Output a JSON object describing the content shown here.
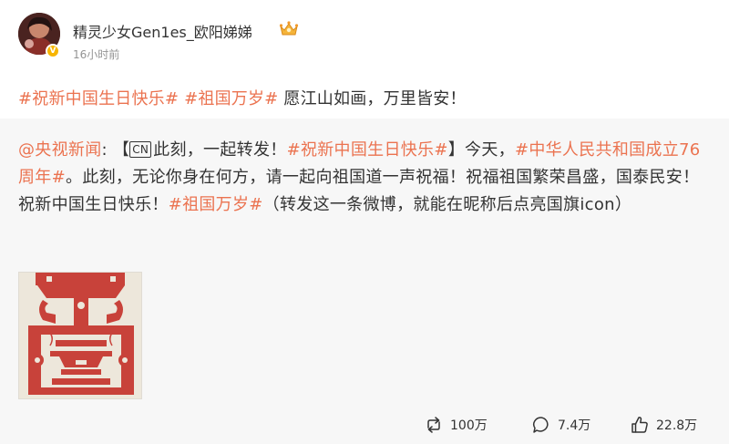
{
  "author": {
    "name": "精灵少女Gen1es_欧阳娣娣",
    "time": "16小时前",
    "verified_color": "#f7b500"
  },
  "post": {
    "topic1": "#祝新中国生日快乐#",
    "topic2": "#祖国万岁#",
    "text": " 愿江山如画，万里皆安！"
  },
  "retweet": {
    "mention": "@央视新闻",
    "sep": ": 【",
    "badge": "CN",
    "seg1": "此刻，一起转发！",
    "topic1": "#祝新中国生日快乐#",
    "seg2": "】今天，",
    "topic2": "#中华人民共和国成立76周年#",
    "seg3": "。此刻，无论你身在何方，请一起向祖国道一声祝福！祝福祖国繁荣昌盛，国泰民安！祝新中国生日快乐！",
    "topic3": "#祖国万岁#",
    "seg4": "（转发这一条微博，就能在昵称后点亮国旗icon）"
  },
  "actions": {
    "repost": "100万",
    "comment": "7.4万",
    "like": "22.8万"
  },
  "colors": {
    "topic": "#eb7350",
    "retweet_bg": "#f7f7f7",
    "meta": "#939393",
    "paper_cut_red": "#c8423a"
  },
  "icons": [
    "verified-v-icon",
    "member-crown-icon",
    "repost-icon",
    "comment-icon",
    "like-icon"
  ]
}
